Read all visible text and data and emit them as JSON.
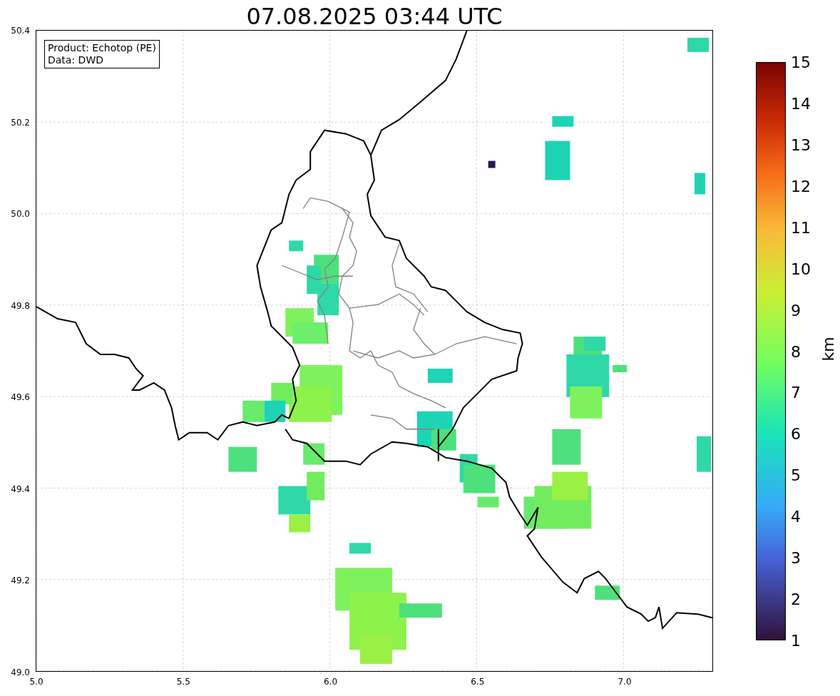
{
  "title": "07.08.2025 03:44 UTC",
  "info_box": {
    "lines": [
      "Product: Echotop (PE)",
      "Data: DWD"
    ]
  },
  "map": {
    "xticks": [
      "5.0",
      "5.5",
      "6.0",
      "6.5",
      "7.0"
    ],
    "yticks": [
      "50.4",
      "50.2",
      "50.0",
      "49.8",
      "49.6",
      "49.4",
      "49.2",
      "49.0"
    ]
  },
  "colorbar": {
    "label": "km",
    "ticks": [
      "15",
      "14",
      "13",
      "12",
      "11",
      "10",
      "9",
      "8",
      "7",
      "6",
      "5",
      "4",
      "3",
      "2",
      "1"
    ]
  }
}
